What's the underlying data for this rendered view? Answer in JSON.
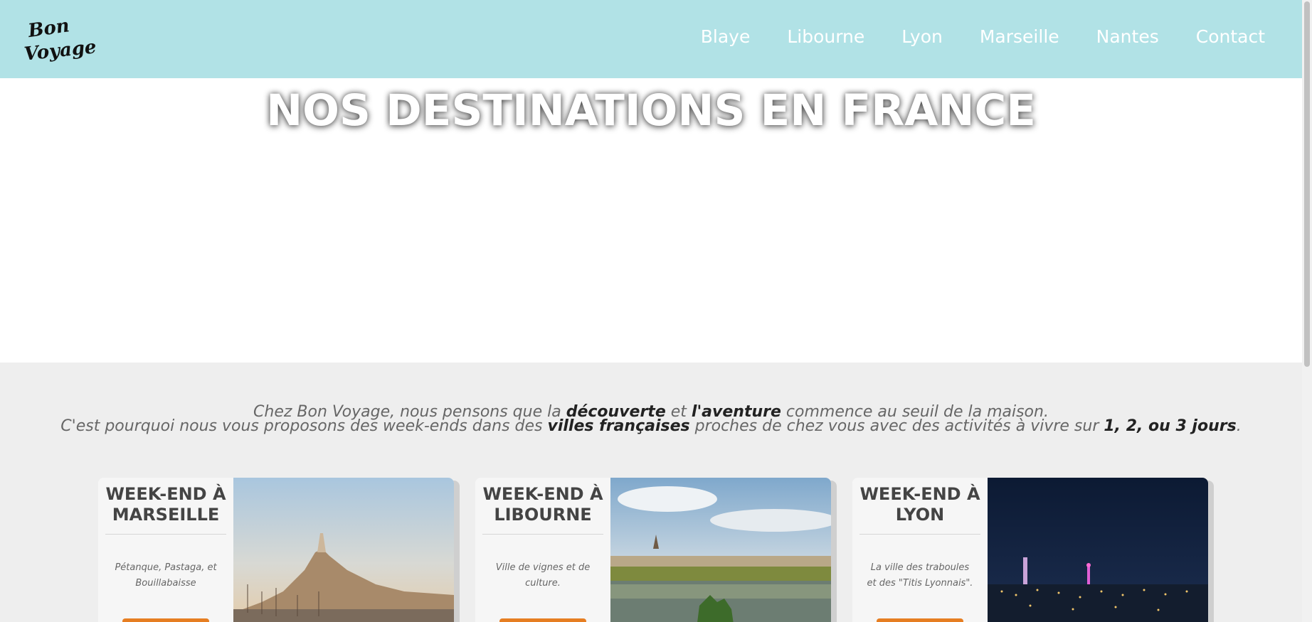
{
  "header": {
    "logo_text": "Bon Voyage!",
    "nav": [
      {
        "label": "Blaye"
      },
      {
        "label": "Libourne"
      },
      {
        "label": "Lyon"
      },
      {
        "label": "Marseille"
      },
      {
        "label": "Nantes"
      },
      {
        "label": "Contact"
      }
    ]
  },
  "hero": {
    "title": "NOS DESTINATIONS EN FRANCE"
  },
  "intro": {
    "line1_a": "Chez Bon Voyage, nous pensons que la ",
    "line1_b": "découverte",
    "line1_c": " et ",
    "line1_d": "l'aventure",
    "line1_e": " commence au seuil de la maison.",
    "line2_a": "C'est pourquoi nous vous proposons des week-ends dans des ",
    "line2_b": "villes françaises",
    "line2_c": " proches de chez vous avec des activités à vivre sur ",
    "line2_d": "1, 2, ou 3 jours",
    "line2_e": "."
  },
  "cards": [
    {
      "title_1": "WEEK-END À",
      "title_2": "MARSEILLE",
      "desc": "Pétanque, Pastaga, et Bouillabaisse"
    },
    {
      "title_1": "WEEK-END À",
      "title_2": "LIBOURNE",
      "desc": "Ville de vignes et de culture."
    },
    {
      "title_1": "WEEK-END À",
      "title_2": "LYON",
      "desc": "La ville des traboules et des \"Titis Lyonnais\"."
    }
  ],
  "colors": {
    "header_bg": "#b1e2e6",
    "section_bg": "#eeeeee",
    "button": "#e67e22"
  }
}
